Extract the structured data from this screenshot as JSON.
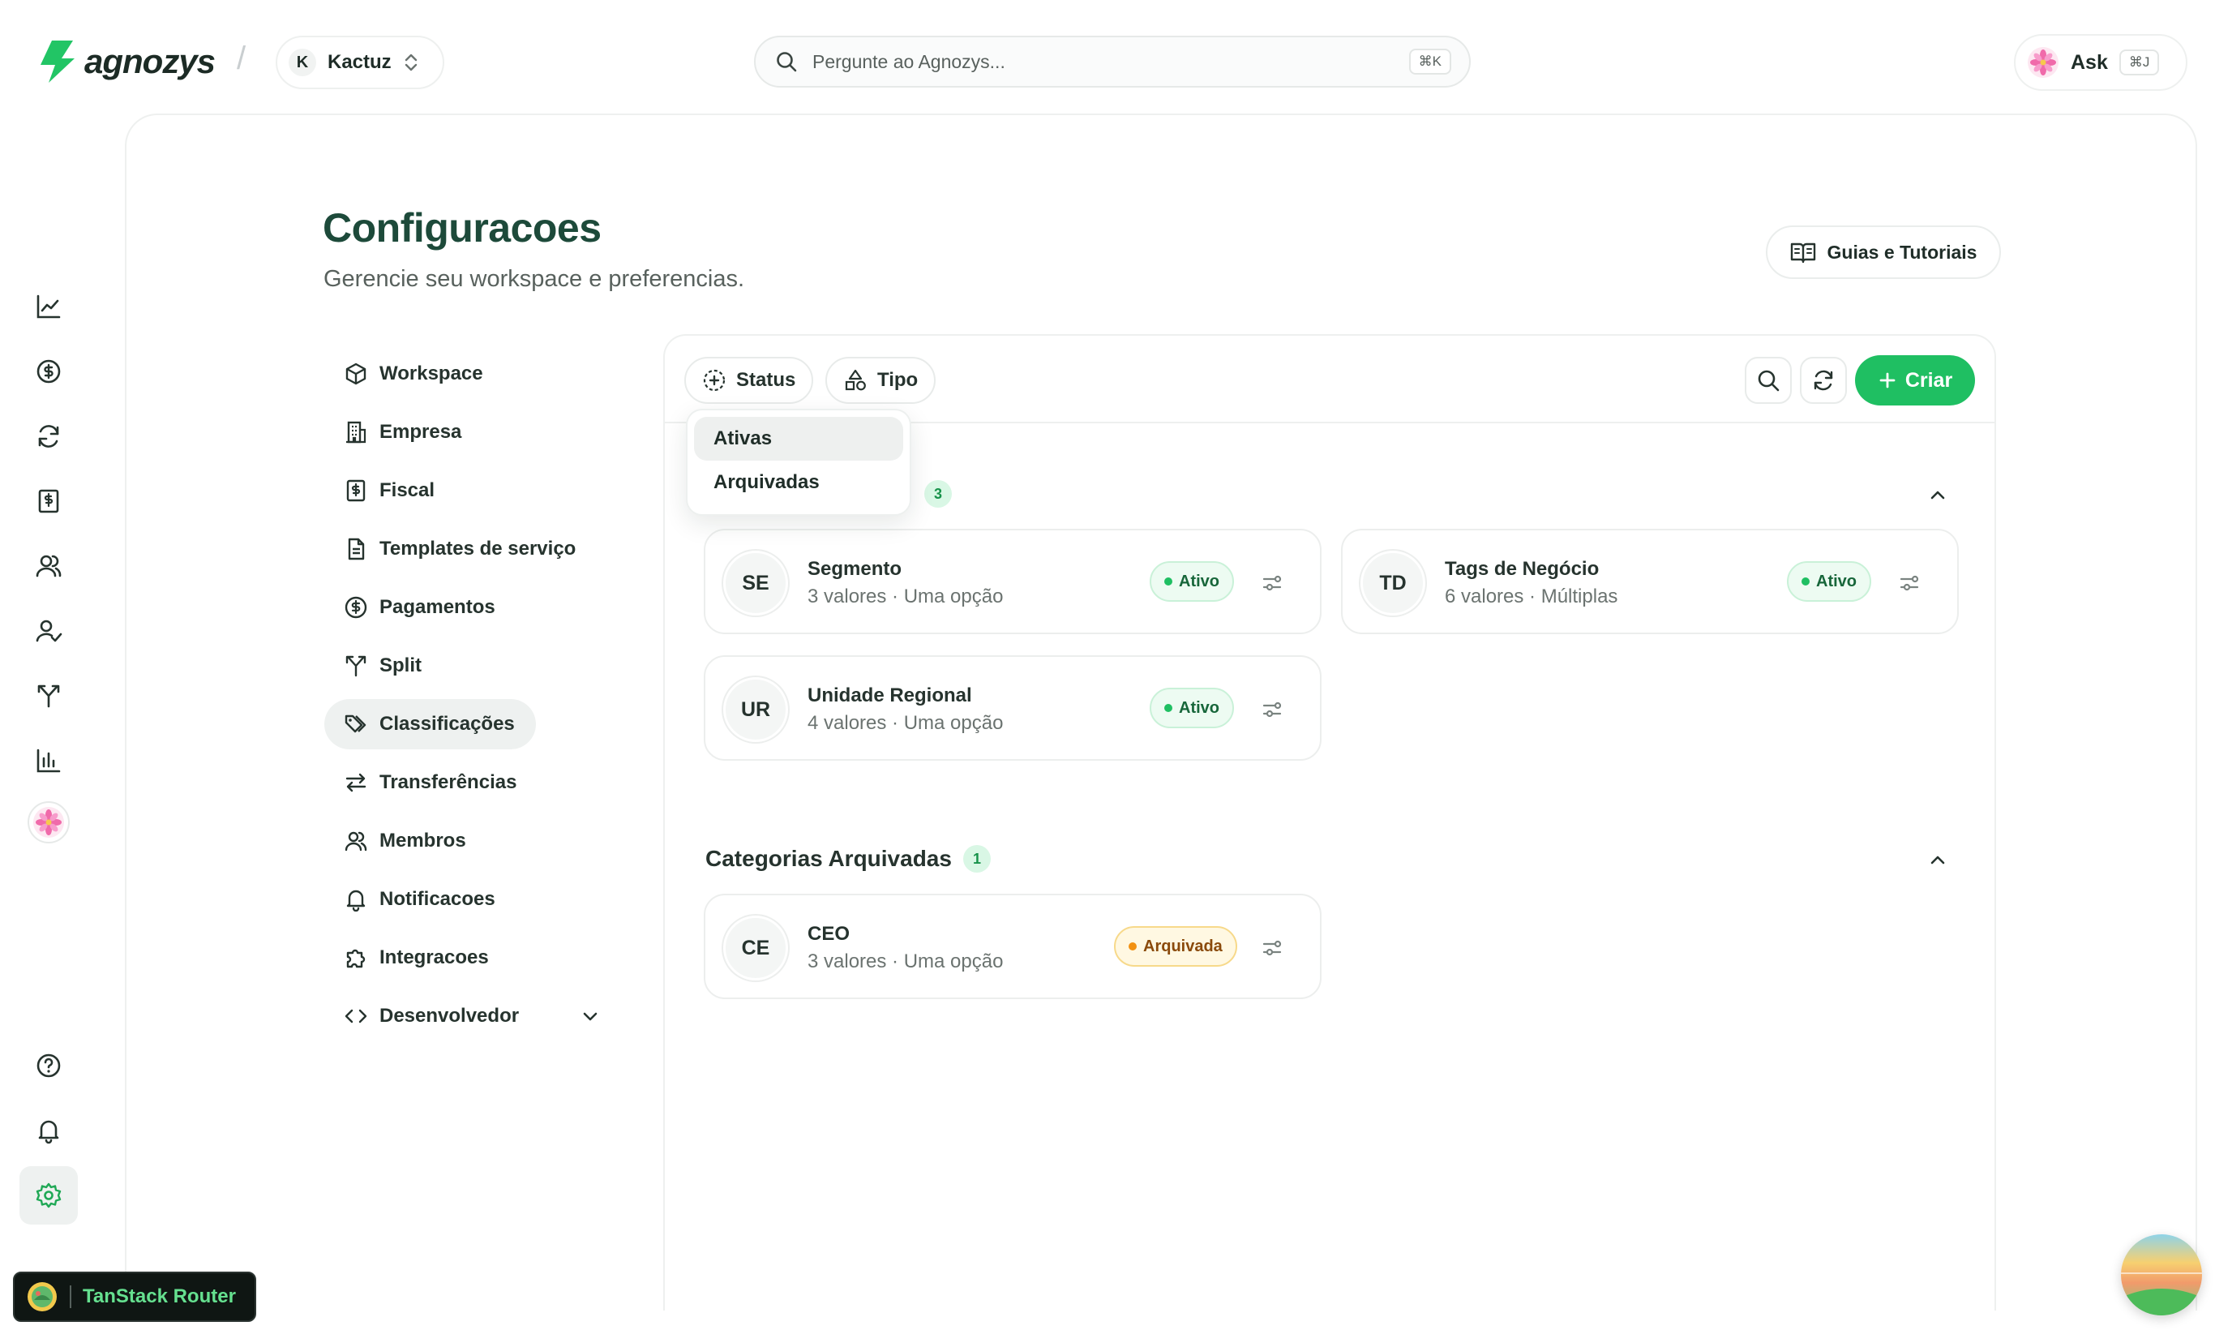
{
  "topbar": {
    "brand": "agnozys",
    "separator": "/",
    "workspace": {
      "initial": "K",
      "name": "Kactuz"
    },
    "search": {
      "placeholder": "Pergunte ao Agnozys...",
      "shortcut": "⌘K"
    },
    "ask": {
      "label": "Ask",
      "shortcut": "⌘J"
    }
  },
  "rail": {
    "items": [
      {
        "icon": "chart-line-icon"
      },
      {
        "icon": "dollar-circle-icon"
      },
      {
        "icon": "refresh-icon"
      },
      {
        "icon": "invoice-dollar-icon"
      },
      {
        "icon": "users-icon"
      },
      {
        "icon": "user-check-icon"
      },
      {
        "icon": "split-arrow-icon"
      },
      {
        "icon": "bar-chart-icon"
      },
      {
        "icon": "flower-avatar-icon"
      },
      {
        "icon": "help-circle-icon"
      },
      {
        "icon": "bell-icon"
      },
      {
        "icon": "gear-icon"
      }
    ]
  },
  "page": {
    "title": "Configuracoes",
    "subtitle": "Gerencie seu workspace e preferencias.",
    "guides_label": "Guias e Tutoriais"
  },
  "settings_nav": {
    "items": [
      {
        "label": "Workspace",
        "icon": "cube-icon"
      },
      {
        "label": "Empresa",
        "icon": "building-icon"
      },
      {
        "label": "Fiscal",
        "icon": "fiscal-icon"
      },
      {
        "label": "Templates de serviço",
        "icon": "document-icon"
      },
      {
        "label": "Pagamentos",
        "icon": "dollar-circle-icon"
      },
      {
        "label": "Split",
        "icon": "split-arrow-icon"
      },
      {
        "label": "Classificações",
        "icon": "tags-icon",
        "active": true
      },
      {
        "label": "Transferências",
        "icon": "transfer-icon"
      },
      {
        "label": "Membros",
        "icon": "users-icon"
      },
      {
        "label": "Notificacoes",
        "icon": "bell-icon"
      },
      {
        "label": "Integracoes",
        "icon": "puzzle-icon"
      },
      {
        "label": "Desenvolvedor",
        "icon": "code-icon",
        "expandable": true
      }
    ]
  },
  "toolbar": {
    "status_label": "Status",
    "type_label": "Tipo",
    "create_label": "Criar"
  },
  "status_dropdown": {
    "options": [
      "Ativas",
      "Arquivadas"
    ],
    "selected": "Ativas"
  },
  "active_section": {
    "count": "3",
    "cards": [
      {
        "initials": "SE",
        "name": "Segmento",
        "meta": "3 valores · Uma opção",
        "status": "Ativo"
      },
      {
        "initials": "TD",
        "name": "Tags de Negócio",
        "meta": "6 valores · Múltiplas",
        "status": "Ativo"
      },
      {
        "initials": "UR",
        "name": "Unidade Regional",
        "meta": "4 valores · Uma opção",
        "status": "Ativo"
      }
    ]
  },
  "archived_section": {
    "title": "Categorias Arquivadas",
    "count": "1",
    "cards": [
      {
        "initials": "CE",
        "name": "CEO",
        "meta": "3 valores · Uma opção",
        "status": "Arquivada"
      }
    ]
  },
  "devtools": {
    "label": "TanStack Router"
  },
  "colors": {
    "brand_green": "#1fbf62",
    "title_green": "#1d4a3a",
    "active_badge_bg": "#edfbf2",
    "archived_badge_bg": "#fff8e2"
  }
}
